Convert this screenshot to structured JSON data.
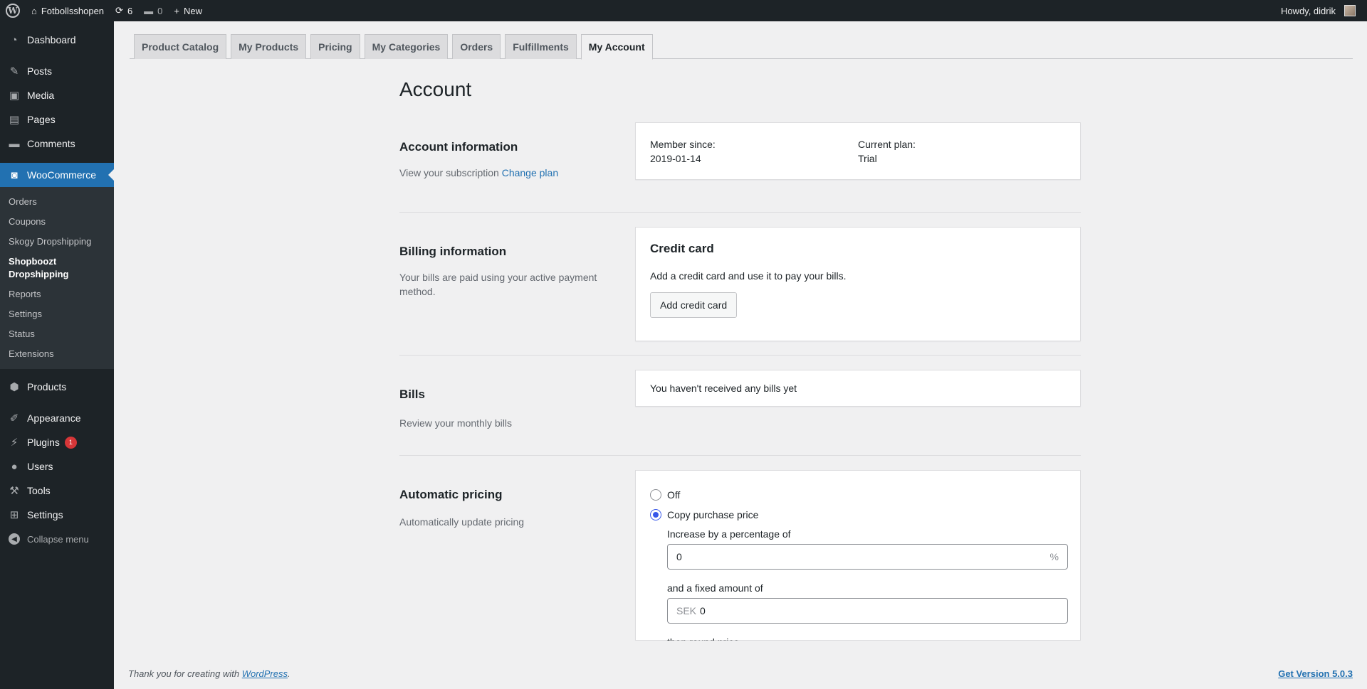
{
  "admin_bar": {
    "site_name": "Fotbollsshopen",
    "updates_count": "6",
    "comments_count": "0",
    "new_label": "New",
    "greeting": "Howdy, didrik"
  },
  "sidebar": {
    "items_top": [
      {
        "label": "Dashboard",
        "icon": "dashboard-icon"
      },
      {
        "label": "Posts",
        "icon": "pin-icon"
      },
      {
        "label": "Media",
        "icon": "media-icon"
      },
      {
        "label": "Pages",
        "icon": "pages-icon"
      },
      {
        "label": "Comments",
        "icon": "comment-icon"
      }
    ],
    "woocommerce": {
      "label": "WooCommerce",
      "icon": "woo-icon"
    },
    "submenu": [
      "Orders",
      "Coupons",
      "Skogy Dropshipping",
      "Shopboozt Dropshipping",
      "Reports",
      "Settings",
      "Status",
      "Extensions"
    ],
    "items_bottom": [
      {
        "label": "Products",
        "icon": "products-icon"
      },
      {
        "label": "Appearance",
        "icon": "brush-icon"
      },
      {
        "label": "Plugins",
        "icon": "plug-icon",
        "badge": "1"
      },
      {
        "label": "Users",
        "icon": "user-icon"
      },
      {
        "label": "Tools",
        "icon": "wrench-icon"
      },
      {
        "label": "Settings",
        "icon": "settings-icon"
      }
    ],
    "collapse_label": "Collapse menu"
  },
  "tabs": [
    "Product Catalog",
    "My Products",
    "Pricing",
    "My Categories",
    "Orders",
    "Fulfillments",
    "My Account"
  ],
  "active_tab": "My Account",
  "page": {
    "title": "Account",
    "account": {
      "heading": "Account information",
      "desc": "View your subscription",
      "change_plan": "Change plan",
      "member_since_label": "Member since:",
      "member_since_value": "2019-01-14",
      "plan_label": "Current plan:",
      "plan_value": "Trial"
    },
    "billing": {
      "heading": "Billing information",
      "desc": "Your bills are paid using your active payment method.",
      "card_title": "Credit card",
      "card_text": "Add a credit card and use it to pay your bills.",
      "button": "Add credit card"
    },
    "bills": {
      "heading": "Bills",
      "desc": "Review your monthly bills",
      "empty": "You haven't received any bills yet"
    },
    "pricing": {
      "heading": "Automatic pricing",
      "desc": "Automatically update pricing",
      "option_off": "Off",
      "option_copy": "Copy purchase price",
      "selected": "Copy purchase price",
      "percentage_label": "Increase by a percentage of",
      "percentage_value": "0",
      "percentage_suffix": "%",
      "fixed_label": "and a fixed amount of",
      "fixed_prefix": "SEK",
      "fixed_value": "0",
      "round_label": "then round price"
    }
  },
  "footer": {
    "thanks_prefix": "Thank you for creating with ",
    "wordpress_link": "WordPress",
    "thanks_suffix": ".",
    "version": "Get Version 5.0.3"
  }
}
